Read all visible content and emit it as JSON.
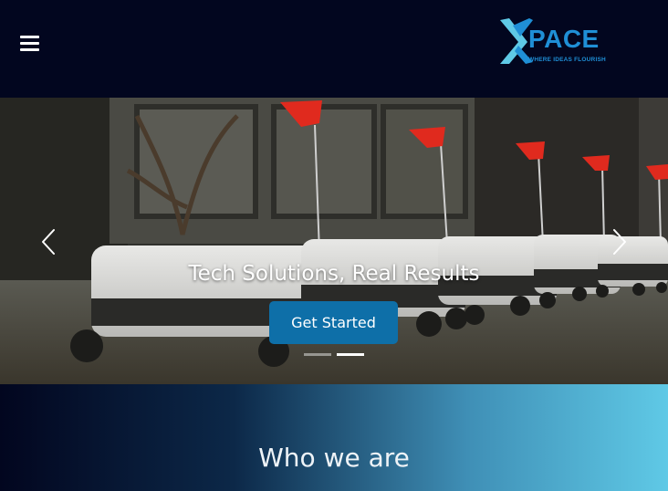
{
  "header": {
    "menu_icon": "hamburger-menu-icon",
    "logo": {
      "name": "PACE",
      "tagline": "WHERE IDEAS FLOURISH",
      "color": "#1f8fd6"
    }
  },
  "hero": {
    "title": "Tech Solutions, Real Results",
    "cta_label": "Get Started",
    "cta_color": "#0e6fa8",
    "prev_icon": "chevron-left-icon",
    "next_icon": "chevron-right-icon",
    "slide_count": 2,
    "active_slide": 2
  },
  "about": {
    "title": "Who we are"
  },
  "colors": {
    "header_bg": "#02061f",
    "gradient_end": "#5fc9e6"
  }
}
